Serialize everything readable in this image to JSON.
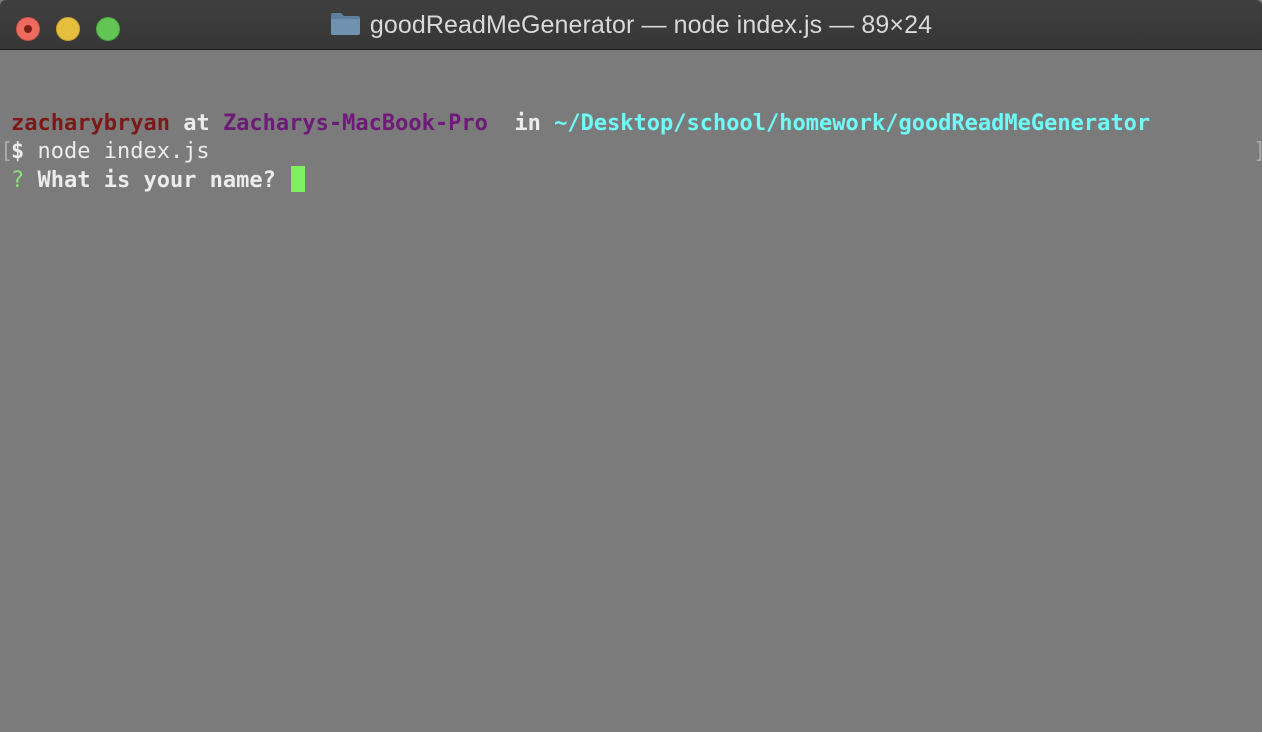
{
  "window": {
    "title": "goodReadMeGenerator — node index.js — 89×24",
    "folder_icon": "folder-icon",
    "controls": {
      "close_icon": "close-icon",
      "minimize_icon": "minimize-icon",
      "maximize_icon": "maximize-icon"
    }
  },
  "terminal": {
    "prompt": {
      "user": "zacharybryan",
      "at": " at ",
      "host": "Zacharys-MacBook-Pro",
      "in": "  in ",
      "path": "~/Desktop/school/homework/goodReadMeGenerator"
    },
    "command_line": {
      "bracket_left": "[",
      "symbol": "$",
      "command": " node index.js",
      "bracket_right": "]"
    },
    "question_line": {
      "marker": "?",
      "question": " What is your name? "
    }
  },
  "colors": {
    "background": "#7b7b7b",
    "user": "#7e1818",
    "host": "#6d1a78",
    "path": "#6ffcf8",
    "question_marker": "#8ce07a",
    "cursor": "#7ef05f"
  }
}
